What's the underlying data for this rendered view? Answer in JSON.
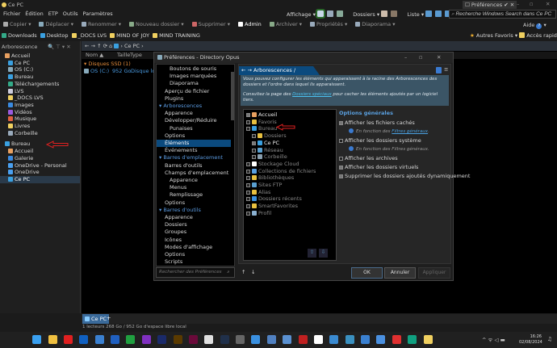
{
  "window": {
    "title": "Ce PC",
    "prefs_tab": "Préférences"
  },
  "menu": [
    "Fichier",
    "Édition",
    "ETP",
    "Outils",
    "Paramètres"
  ],
  "toolbar": {
    "left": [
      "Copier",
      "Déplacer",
      "Renommer",
      "Nouveau dossier",
      "Supprimer",
      "Admin",
      "Archiver",
      "Propriétés",
      "Diaporama"
    ],
    "affichage": "Affichage",
    "dossiers": "Dossiers",
    "liste": "Liste",
    "search_placeholder": "Recherche Windows Search dans Ce PC",
    "aide": "Aide"
  },
  "favorites": {
    "items": [
      "Downloads",
      "Desktop",
      "_DOCS LVS",
      "MIND OF JOY",
      "MIND TRAINING"
    ],
    "autres": "Autres Favoris",
    "acces": "Accès rapide"
  },
  "tree": {
    "header": "Arborescence",
    "items": [
      {
        "label": "Accueil",
        "level": 0,
        "icon": "home"
      },
      {
        "label": "Ce PC",
        "level": 1,
        "icon": "pc"
      },
      {
        "label": "OS (C:)",
        "level": 1,
        "icon": "drive"
      },
      {
        "label": "Bureau",
        "level": 1,
        "icon": "desktop"
      },
      {
        "label": "Téléchargements",
        "level": 1,
        "icon": "download"
      },
      {
        "label": "LVS",
        "level": 1,
        "icon": "doc"
      },
      {
        "label": "_DOCS LVS",
        "level": 1,
        "icon": "folder"
      },
      {
        "label": "Images",
        "level": 1,
        "icon": "images"
      },
      {
        "label": "Vidéos",
        "level": 1,
        "icon": "videos"
      },
      {
        "label": "Musique",
        "level": 1,
        "icon": "music"
      },
      {
        "label": "Livres",
        "level": 1,
        "icon": "books"
      },
      {
        "label": "Corbeille",
        "level": 1,
        "icon": "trash"
      },
      {
        "label": "Bureau",
        "level": 0,
        "icon": "desktop",
        "gap": true
      },
      {
        "label": "Accueil",
        "level": 1,
        "icon": "home"
      },
      {
        "label": "Galerie",
        "level": 1,
        "icon": "images"
      },
      {
        "label": "OneDrive - Personal",
        "level": 1,
        "icon": "cloud"
      },
      {
        "label": "OneDrive",
        "level": 1,
        "icon": "cloud"
      },
      {
        "label": "Ce PC",
        "level": 1,
        "icon": "pc",
        "selected": true
      }
    ]
  },
  "nav": {
    "location": "Ce PC"
  },
  "columns": [
    "Nom",
    "Taille",
    "Type"
  ],
  "files": {
    "group": "Disques SSD (1)",
    "rows": [
      {
        "name": "OS (C:)",
        "size": "952 Go",
        "type": "Disque local"
      }
    ]
  },
  "dialog": {
    "title": "Préférences - Directory Opus",
    "sidebar": [
      {
        "label": "Boutons de souris",
        "level": 2
      },
      {
        "label": "Images marquées",
        "level": 2
      },
      {
        "label": "Diaporama",
        "level": 2
      },
      {
        "label": "Aperçu de fichier",
        "level": 1
      },
      {
        "label": "Plugins",
        "level": 1
      },
      {
        "label": "Arborescences",
        "level": 0
      },
      {
        "label": "Apparence",
        "level": 1
      },
      {
        "label": "Développer/Réduire",
        "level": 1
      },
      {
        "label": "Punaises",
        "level": 2
      },
      {
        "label": "Options",
        "level": 1
      },
      {
        "label": "Éléments",
        "level": 1,
        "selected": true
      },
      {
        "label": "Événements",
        "level": 1
      },
      {
        "label": "Barres d'emplacement",
        "level": 0
      },
      {
        "label": "Barres d'outils",
        "level": 1
      },
      {
        "label": "Champs d'emplacement",
        "level": 1
      },
      {
        "label": "Apparence",
        "level": 2
      },
      {
        "label": "Menus",
        "level": 2
      },
      {
        "label": "Remplissage",
        "level": 2
      },
      {
        "label": "Options",
        "level": 1
      },
      {
        "label": "Barres d'outils",
        "level": 0
      },
      {
        "label": "Apparence",
        "level": 1
      },
      {
        "label": "Dossiers",
        "level": 1
      },
      {
        "label": "Groupes",
        "level": 1
      },
      {
        "label": "Icônes",
        "level": 1
      },
      {
        "label": "Modes d'affichage",
        "level": 1
      },
      {
        "label": "Options",
        "level": 1
      },
      {
        "label": "Scripts",
        "level": 1
      }
    ],
    "search_placeholder": "Rechercher des Préférences",
    "breadcrumb": "Arborescences / Éléments",
    "info1": "Vous pouvez configurer les éléments qui apparaissent à la racine des Arborescences des dossiers et l'ordre dans lequel ils apparaissent.",
    "info2_a": "Consultez la page des ",
    "info2_link": "Dossiers spéciaux",
    "info2_b": " pour cacher les éléments ajoutés par un logiciel tiers.",
    "elements": [
      {
        "label": "Accueil",
        "level": 0,
        "checked": true,
        "on": true,
        "color": "#e8a060"
      },
      {
        "label": "Favoris",
        "level": 0,
        "checked": false,
        "color": "#e8c040"
      },
      {
        "label": "Bureau",
        "level": 0,
        "checked": false,
        "color": "#3aa0e0"
      },
      {
        "label": "Dossiers",
        "level": 1,
        "checked": false,
        "color": "#e8c040"
      },
      {
        "label": "Ce PC",
        "level": 1,
        "checked": true,
        "on": true,
        "color": "#3aa0e0"
      },
      {
        "label": "Réseau",
        "level": 1,
        "checked": false,
        "color": "#5aa0d0"
      },
      {
        "label": "Corbeille",
        "level": 1,
        "checked": false,
        "color": "#8aa0b0"
      },
      {
        "label": "Stockage Cloud",
        "level": 0,
        "checked": false,
        "color": "#ffffff"
      },
      {
        "label": "Collections de fichiers",
        "level": 0,
        "checked": false,
        "color": "#5aa0e0"
      },
      {
        "label": "Bibliothèques",
        "level": 0,
        "checked": false,
        "color": "#e8c040"
      },
      {
        "label": "Sites FTP",
        "level": 0,
        "checked": false,
        "color": "#5aa0d0"
      },
      {
        "label": "Alias",
        "level": 0,
        "checked": false,
        "color": "#e8c040"
      },
      {
        "label": "Dossiers récents",
        "level": 0,
        "checked": false,
        "color": "#3a90e0"
      },
      {
        "label": "SmartFavorites",
        "level": 0,
        "checked": false,
        "color": "#e8c040"
      },
      {
        "label": "Profil",
        "level": 0,
        "checked": false,
        "color": "#8ab0d0"
      }
    ],
    "options_title": "Options générales",
    "options": [
      {
        "label": "Afficher les fichiers cachés",
        "checked": true,
        "note_a": "En fonction des ",
        "note_link": "Filtres généraux",
        "note_b": "."
      },
      {
        "label": "Afficher les dossiers système",
        "checked": false,
        "note_a": "En fonction des Filtres généraux.",
        "note_link": "",
        "note_b": ""
      },
      {
        "label": "Afficher les archives",
        "checked": false
      },
      {
        "label": "Afficher les dossiers virtuels",
        "checked": true
      },
      {
        "label": "Supprimer les dossiers ajoutés dynamiquement",
        "checked": true
      }
    ],
    "ok": "OK",
    "cancel": "Annuler",
    "apply": "Appliquer"
  },
  "bottom": {
    "tab": "Ce PC",
    "status": "1 lecteurs 268 Go / 952 Go d'espace libre local"
  },
  "taskbar": {
    "time": "16:26",
    "date": "02/08/2024",
    "apps": [
      "#3aa0f0",
      "#f0c040",
      "#e02020",
      "#1060c0",
      "#3a80d0",
      "#2060c0",
      "#20a040",
      "#8030c0",
      "#1a2a6a",
      "#5a3a00",
      "#6a0a3a",
      "#e0e0e0",
      "#20304a",
      "#666666",
      "#3a90e0",
      "#5080c0",
      "#5a90d0",
      "#c02020",
      "#ffffff",
      "#3a8ad0",
      "#3a90c0",
      "#3a80d0",
      "#4a90e0",
      "#e03030",
      "#10a080",
      "#f0d060"
    ]
  },
  "colors": {
    "accent": "#0b4a7e",
    "arrow": "#e02020",
    "header": "#e08a3a",
    "link": "#4aa0e0"
  }
}
